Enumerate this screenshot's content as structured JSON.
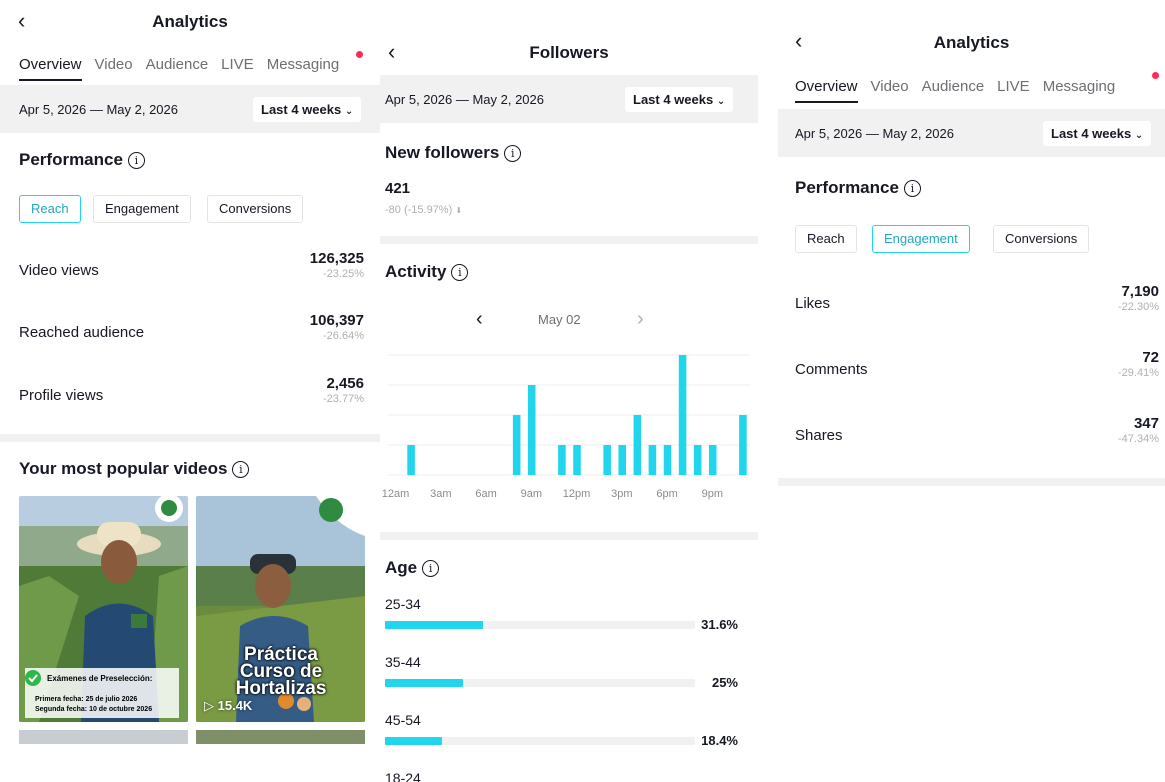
{
  "colors": {
    "accent": "#20d5ec",
    "notification": "#fe2c55",
    "muted": "#b0b0b3",
    "divider": "#f1f1f2"
  },
  "left": {
    "title": "Analytics",
    "tabs": [
      "Overview",
      "Video",
      "Audience",
      "LIVE",
      "Messaging"
    ],
    "date_range": "Apr 5, 2026 — May 2, 2026",
    "period": "Last 4 weeks",
    "performance_title": "Performance",
    "chips": [
      "Reach",
      "Engagement",
      "Conversions"
    ],
    "metrics": [
      {
        "label": "Video views",
        "value": "126,325",
        "delta": "-23.25%"
      },
      {
        "label": "Reached audience",
        "value": "106,397",
        "delta": "-26.64%"
      },
      {
        "label": "Profile views",
        "value": "2,456",
        "delta": "-23.77%"
      }
    ],
    "popular_title": "Your most popular videos",
    "videos": [
      {
        "caption1": "Exámenes de Preselección:",
        "caption2": "Primera fecha: 25 de julio 2026",
        "caption3": "Segunda fecha: 10 de octubre 2026"
      },
      {
        "overlay": "Práctica Curso de Hortalizas",
        "views": "15.4K"
      }
    ]
  },
  "middle": {
    "title": "Followers",
    "date_range": "Apr 5, 2026 — May 2, 2026",
    "period": "Last 4 weeks",
    "new_followers_title": "New followers",
    "new_followers_value": "421",
    "new_followers_delta": "-80 (-15.97%)",
    "activity_title": "Activity",
    "activity_day": "May 02",
    "age_title": "Age",
    "ages": [
      {
        "label": "25-34",
        "pct": "31.6%",
        "frac": 0.316
      },
      {
        "label": "35-44",
        "pct": "25%",
        "frac": 0.25
      },
      {
        "label": "45-54",
        "pct": "18.4%",
        "frac": 0.184
      },
      {
        "label": "18-24",
        "pct": "",
        "frac": 0
      }
    ]
  },
  "right": {
    "title": "Analytics",
    "tabs": [
      "Overview",
      "Video",
      "Audience",
      "LIVE",
      "Messaging"
    ],
    "date_range": "Apr 5, 2026 — May 2, 2026",
    "period": "Last 4 weeks",
    "performance_title": "Performance",
    "chips": [
      "Reach",
      "Engagement",
      "Conversions"
    ],
    "metrics": [
      {
        "label": "Likes",
        "value": "7,190",
        "delta": "-22.30%"
      },
      {
        "label": "Comments",
        "value": "72",
        "delta": "-29.41%"
      },
      {
        "label": "Shares",
        "value": "347",
        "delta": "-47.34%"
      }
    ]
  },
  "chart_data": {
    "type": "bar",
    "title": "Activity",
    "categories": [
      "12am",
      "1am",
      "2am",
      "3am",
      "4am",
      "5am",
      "6am",
      "7am",
      "8am",
      "9am",
      "10am",
      "11am",
      "12pm",
      "1pm",
      "2pm",
      "3pm",
      "4pm",
      "5pm",
      "6pm",
      "7pm",
      "8pm",
      "9pm",
      "10pm",
      "11pm"
    ],
    "tick_labels": [
      "12am",
      "3am",
      "6am",
      "9am",
      "12pm",
      "3pm",
      "6pm",
      "9pm"
    ],
    "values": [
      0,
      1,
      0,
      0,
      0,
      0,
      0,
      0,
      2,
      3,
      0,
      1,
      1,
      0,
      1,
      1,
      2,
      1,
      1,
      4,
      1,
      1,
      0,
      2
    ],
    "ylim": [
      0,
      4
    ],
    "grid": true
  }
}
